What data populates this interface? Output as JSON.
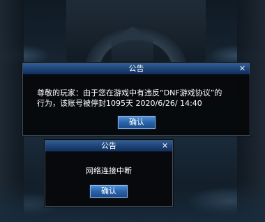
{
  "dialog_ban": {
    "title": "公告",
    "close_glyph": "✕",
    "message_line1": "尊敬的玩家：由于您在游戏中有违反“DNF游戏协议”的",
    "message_line2": "行为，该账号被停封1095天 2020/6/26/ 14:40",
    "confirm_label": "确认"
  },
  "dialog_network": {
    "title": "公告",
    "close_glyph": "✕",
    "message": "网络连接中断",
    "confirm_label": "确认"
  },
  "colors": {
    "titlebar": "#1d4275",
    "button": "#2a62a8",
    "dialog_bg": "#06080a"
  }
}
